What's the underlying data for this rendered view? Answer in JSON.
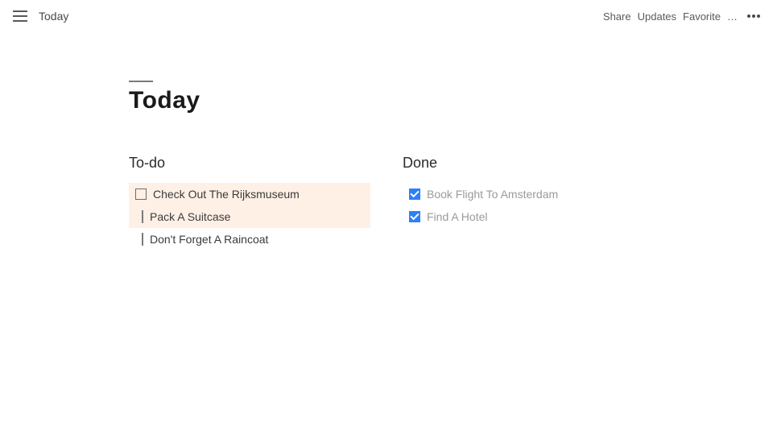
{
  "header": {
    "breadcrumb": "Today",
    "actions": {
      "share": "Share",
      "updates": "Updates",
      "favorite": "Favorite",
      "overflow": "…"
    }
  },
  "page": {
    "title": "Today"
  },
  "board": {
    "todo": {
      "header": "To-do",
      "items": [
        {
          "text": "Check Out The Rijksmuseum",
          "checked": false,
          "highlighted": true,
          "showCheckbox": true
        },
        {
          "text": "Pack A Suitcase",
          "checked": false,
          "highlighted": true,
          "showCheckbox": false
        },
        {
          "text": "Don't Forget A Raincoat",
          "checked": false,
          "highlighted": false,
          "showCheckbox": false
        }
      ]
    },
    "done": {
      "header": "Done",
      "items": [
        {
          "text": "Book Flight To Amsterdam",
          "checked": true
        },
        {
          "text": "Find A Hotel",
          "checked": true
        }
      ]
    }
  }
}
